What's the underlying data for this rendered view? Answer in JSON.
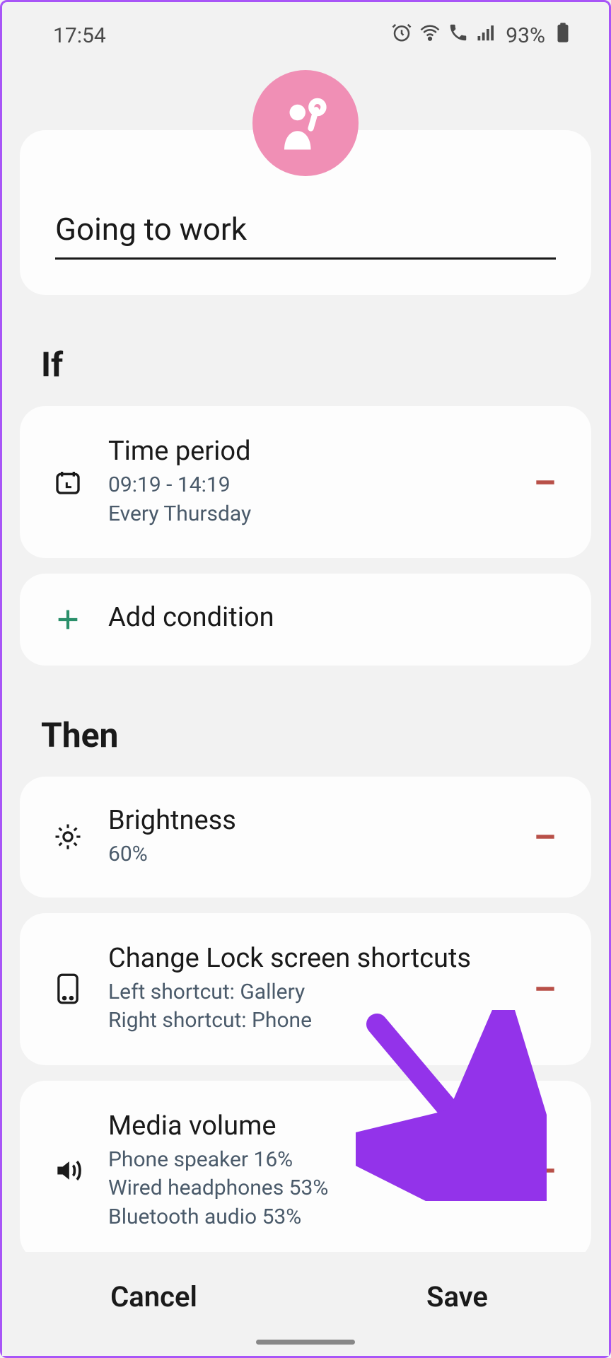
{
  "status": {
    "time": "17:54",
    "battery": "93%"
  },
  "routine": {
    "name": "Going to work"
  },
  "sections": {
    "if": {
      "header": "If",
      "conditions": [
        {
          "title": "Time period",
          "line1": "09:19 - 14:19",
          "line2": "Every Thursday"
        }
      ],
      "add_label": "Add condition"
    },
    "then": {
      "header": "Then",
      "actions": [
        {
          "title": "Brightness",
          "line1": "60%"
        },
        {
          "title": "Change Lock screen shortcuts",
          "line1": "Left shortcut: Gallery",
          "line2": "Right shortcut: Phone"
        },
        {
          "title": "Media volume",
          "line1": "Phone speaker 16%",
          "line2": "Wired headphones 53%",
          "line3": "Bluetooth audio 53%"
        }
      ]
    }
  },
  "buttons": {
    "cancel": "Cancel",
    "save": "Save"
  },
  "colors": {
    "accent": "#f08fb5",
    "remove": "#b85048",
    "add": "#2a8f6a",
    "arrow": "#9333ea"
  }
}
